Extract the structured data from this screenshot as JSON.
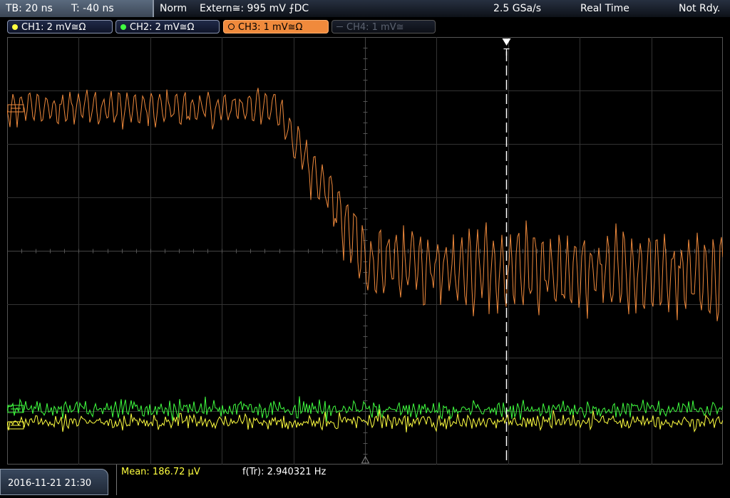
{
  "status_bar": {
    "timebase": "TB: 20 ns",
    "trigger_time": "T: -40 ns",
    "trigger_mode": "Norm",
    "trigger_source": "Extern≅: 995 mV ⨍DC",
    "sample_rate": "2.5 GSa/s",
    "acq_mode": "Real Time",
    "state": "Not Rdy."
  },
  "channels": [
    {
      "label": "CH1: 2 mV≅Ω",
      "color": "#ffff40"
    },
    {
      "label": "CH2: 2 mV≅Ω",
      "color": "#40ff40"
    },
    {
      "label": "CH3: 1 mV≅Ω",
      "color": "#f08a3c"
    },
    {
      "label": "CH4: 1 mV≅",
      "color": "#5b6270"
    }
  ],
  "trigger_marker": "T",
  "footer": {
    "datetime": "2016-11-21 21:30",
    "mean": "Mean: 186.72 µV",
    "freq": "f(Tr): 2.940321 Hz"
  },
  "colors": {
    "ch1": "#ffff40",
    "ch2": "#40ff40",
    "ch3": "#f08a3c",
    "grid": "#3a3a3a",
    "mean_text": "#ffff40"
  }
}
